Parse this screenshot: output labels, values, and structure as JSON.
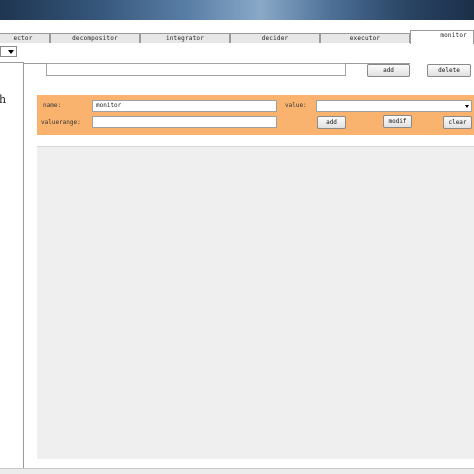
{
  "tabs": [
    {
      "label": "ector"
    },
    {
      "label": "decompositor"
    },
    {
      "label": "integrator"
    },
    {
      "label": "decider"
    },
    {
      "label": "executor"
    },
    {
      "label": "monitor"
    }
  ],
  "active_tab": "monitor",
  "left_panel": {
    "text": "h"
  },
  "toolbar": {
    "search_value": "",
    "add_label": "add",
    "delete_label": "delete"
  },
  "form": {
    "name_label": "name:",
    "name_value": "monitor",
    "value_label": "value:",
    "value_selected": "",
    "valuerange_label": "valuerange:",
    "valuerange_value": "",
    "add_label": "add",
    "modify_label": "modif",
    "clear_label": "clear"
  },
  "colors": {
    "form_background": "#f9b36f",
    "content_background": "#efefef"
  },
  "icons": {
    "combo_arrow": "chevron-down-icon"
  }
}
